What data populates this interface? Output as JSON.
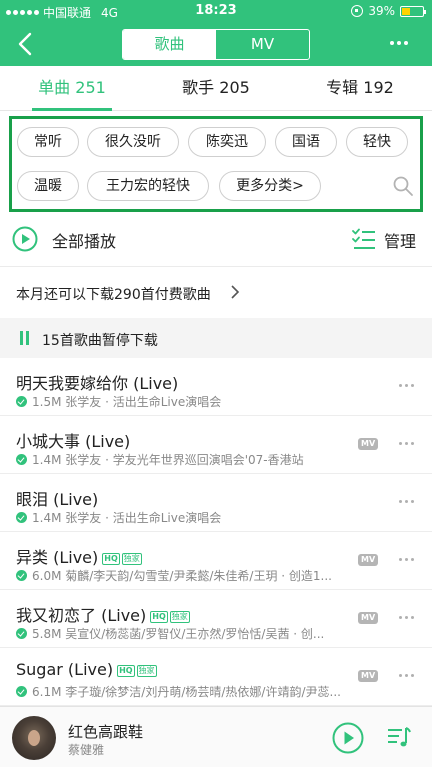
{
  "status_bar": {
    "carrier": "中国联通",
    "network": "4G",
    "time": "18:23",
    "battery": "39%"
  },
  "header": {
    "segments": [
      "歌曲",
      "MV"
    ],
    "active_segment": 0
  },
  "tabs": [
    {
      "label": "单曲 251",
      "active": true
    },
    {
      "label": "歌手 205",
      "active": false
    },
    {
      "label": "专辑 192",
      "active": false
    }
  ],
  "filters": {
    "chips": [
      "常听",
      "很久没听",
      "陈奕迅",
      "国语",
      "轻快",
      "温暖",
      "王力宏的轻快",
      "更多分类>"
    ]
  },
  "actions": {
    "play_all": "全部播放",
    "manage": "管理"
  },
  "quota": {
    "text": "本月还可以下载290首付费歌曲"
  },
  "paused": {
    "text": "15首歌曲暂停下载"
  },
  "songs": [
    {
      "title": "明天我要嫁给你 (Live)",
      "sub": "1.5M 张学友 · 活出生命Live演唱会",
      "hq": false,
      "exclusive": false,
      "mv": false
    },
    {
      "title": "小城大事 (Live)",
      "sub": "1.4M 张学友 · 学友光年世界巡回演唱会'07-香港站",
      "hq": false,
      "exclusive": false,
      "mv": true
    },
    {
      "title": "眼泪 (Live)",
      "sub": "1.4M 张学友 · 活出生命Live演唱会",
      "hq": false,
      "exclusive": false,
      "mv": false
    },
    {
      "title": "异类 (Live)",
      "sub": "6.0M 菊麟/李天韵/勾雪莹/尹柔懿/朱佳希/王玥 · 创造1...",
      "hq": true,
      "exclusive": true,
      "mv": true
    },
    {
      "title": "我又初恋了 (Live)",
      "sub": "5.8M 吴宣仪/杨蕊菡/罗智仪/王亦然/罗怡恬/吴茜 · 创...",
      "hq": true,
      "exclusive": true,
      "mv": true
    },
    {
      "title": "Sugar (Live)",
      "sub": "6.1M 李子璇/徐梦洁/刘丹萌/杨芸晴/热依娜/许靖韵/尹蕊...",
      "hq": true,
      "exclusive": true,
      "mv": true
    }
  ],
  "badges": {
    "hq": "HQ",
    "exclusive": "独家",
    "mv": "MV"
  },
  "player": {
    "title": "红色高跟鞋",
    "artist": "蔡健雅"
  },
  "colors": {
    "brand": "#31c27c",
    "highlight_box": "#19a04a"
  }
}
